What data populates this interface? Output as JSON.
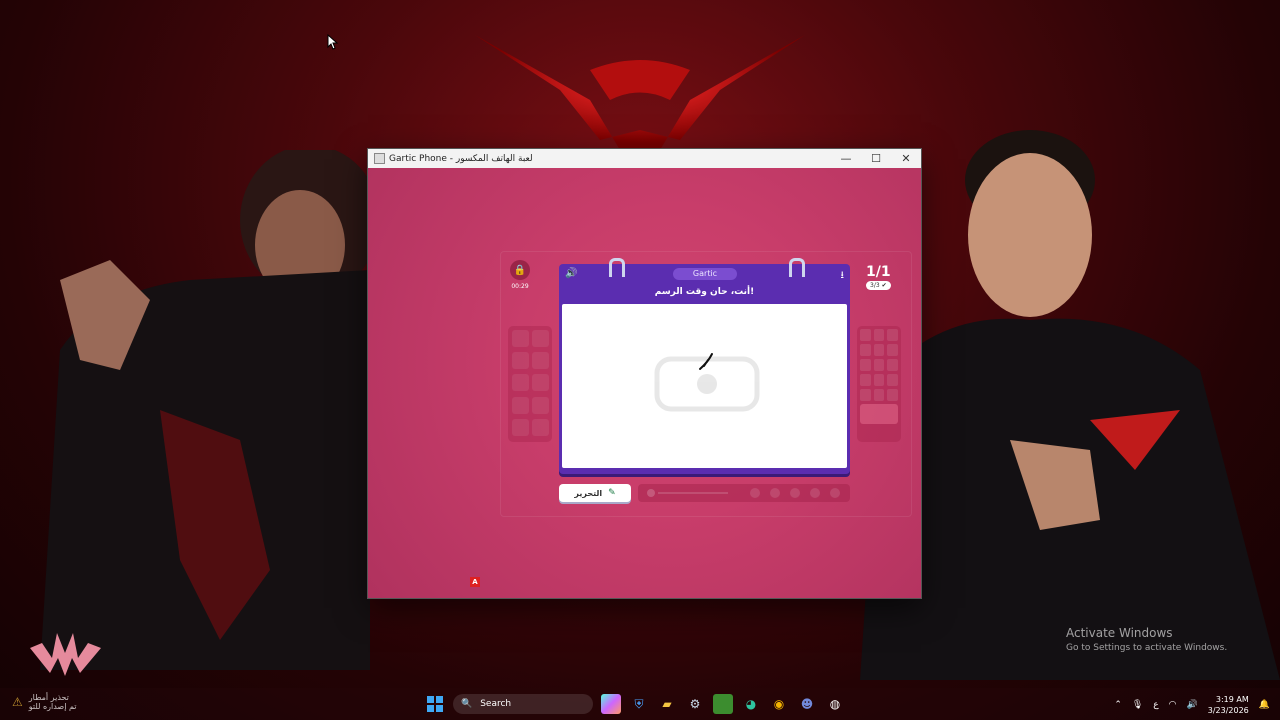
{
  "window": {
    "title": "Gartic Phone - لعبة الهاتف المكسور",
    "minimize": "—",
    "maximize": "☐",
    "close": "✕"
  },
  "game": {
    "timer": "00:29",
    "round": "1/1",
    "players_done": "3/3",
    "brand": "Gartic",
    "prompt": "أنت، حان وقت الرسم!",
    "done_button": "التحرير",
    "letter_badge": "A"
  },
  "desktop": {
    "activate_title": "Activate Windows",
    "activate_sub": "Go to Settings to activate Windows."
  },
  "notification": {
    "line1": "تحذير أمطار",
    "line2": "تم إصداره للتو"
  },
  "taskbar": {
    "search_placeholder": "Search",
    "lang": "ع",
    "time": "3:19 AM",
    "date": "3/23/2026",
    "icons": [
      "windows-start-icon",
      "copilot-icon",
      "defender-icon",
      "file-explorer-icon",
      "steam-icon",
      "minecraft-icon",
      "edge-icon",
      "chrome-icon",
      "discord-icon",
      "gartic-app-icon"
    ]
  },
  "colors": {
    "window_bg": "#c63a6a",
    "card_purple": "#5b2db0",
    "wallpaper_red": "#7a0f14"
  }
}
